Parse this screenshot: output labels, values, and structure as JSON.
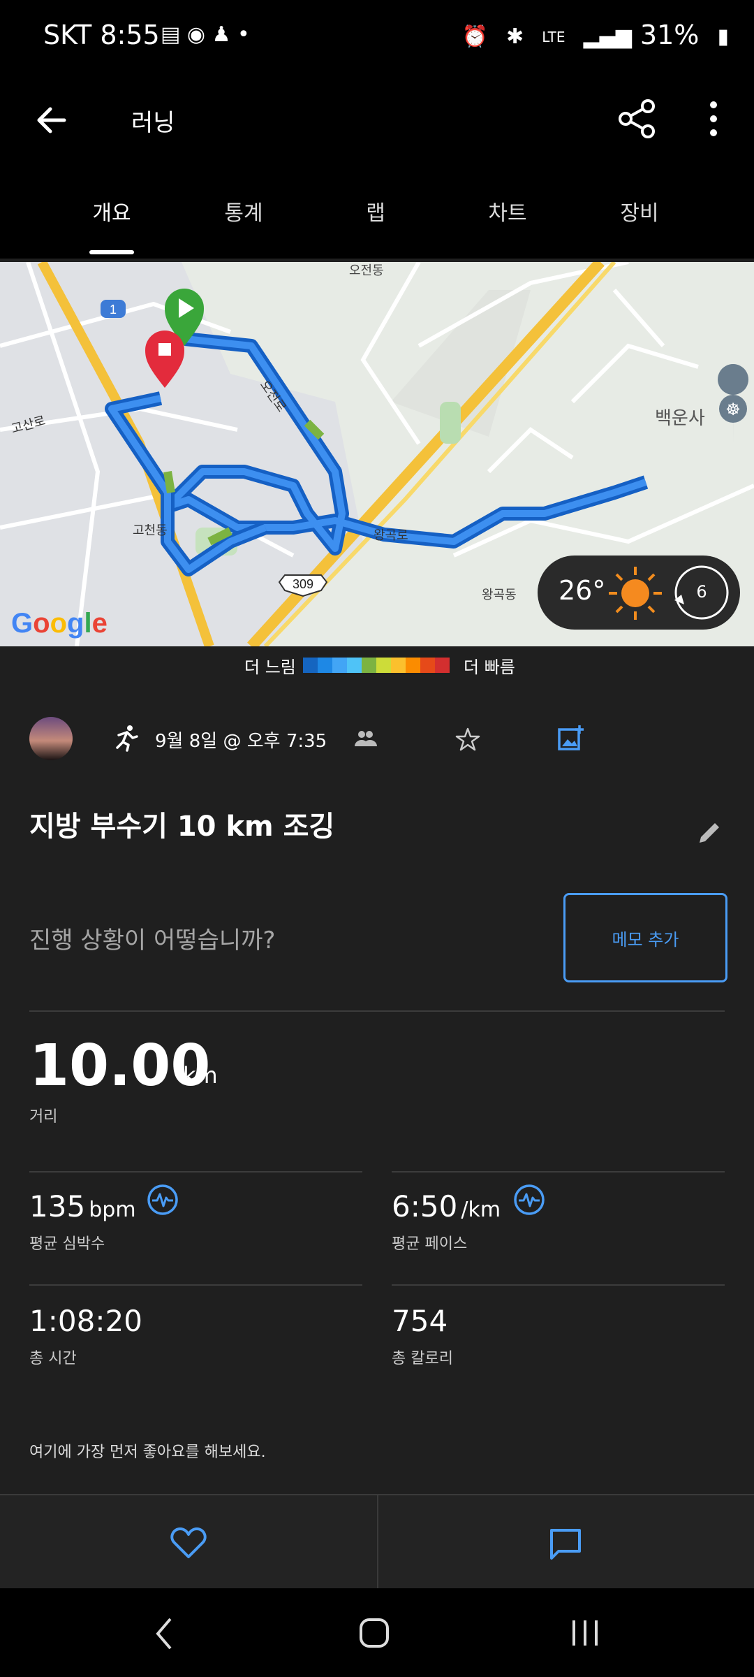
{
  "status_bar": {
    "time": "SKT 8:55",
    "network": "LTE",
    "battery": "31%"
  },
  "app_bar": {
    "title": "러닝"
  },
  "tabs": [
    "개요",
    "통계",
    "랩",
    "차트",
    "장비"
  ],
  "map": {
    "labels": {
      "ojeon_dong": "오전동",
      "ojeon_ro": "오전로",
      "gosan_ro": "고산로",
      "gocheon_dong": "고천동",
      "wanggok_ro": "왕곡로",
      "wanggok_dong": "왕곡동",
      "baegunsa": "백운사",
      "route_1": "1",
      "route_309": "309",
      "google": "Google"
    },
    "weather": {
      "temp": "26°",
      "wind": "6"
    }
  },
  "pace_legend": {
    "slower": "더 느림",
    "faster": "더 빠름",
    "colors": [
      "#1565c0",
      "#1e88e5",
      "#42a5f5",
      "#4fc3f7",
      "#7cb342",
      "#cddc39",
      "#fbc02d",
      "#fb8c00",
      "#e64a19",
      "#d32f2f"
    ]
  },
  "activity": {
    "date": "9월 8일 @ 오후 7:35",
    "title": "지방 부수기 10 km 조깅",
    "note_prompt": "진행 상황이 어떻습니까?",
    "memo_button": "메모 추가"
  },
  "stats": {
    "distance": {
      "value": "10.00",
      "unit": "km",
      "label": "거리"
    },
    "heart_rate": {
      "value": "135",
      "unit": "bpm",
      "label": "평균 심박수"
    },
    "pace": {
      "value": "6:50",
      "unit": "/km",
      "label": "평균 페이스"
    },
    "time": {
      "value": "1:08:20",
      "label": "총 시간"
    },
    "calories": {
      "value": "754",
      "label": "총 칼로리"
    }
  },
  "likes_hint": "여기에 가장 먼저 좋아요를 해보세요.",
  "accent": "#4a9cf5"
}
